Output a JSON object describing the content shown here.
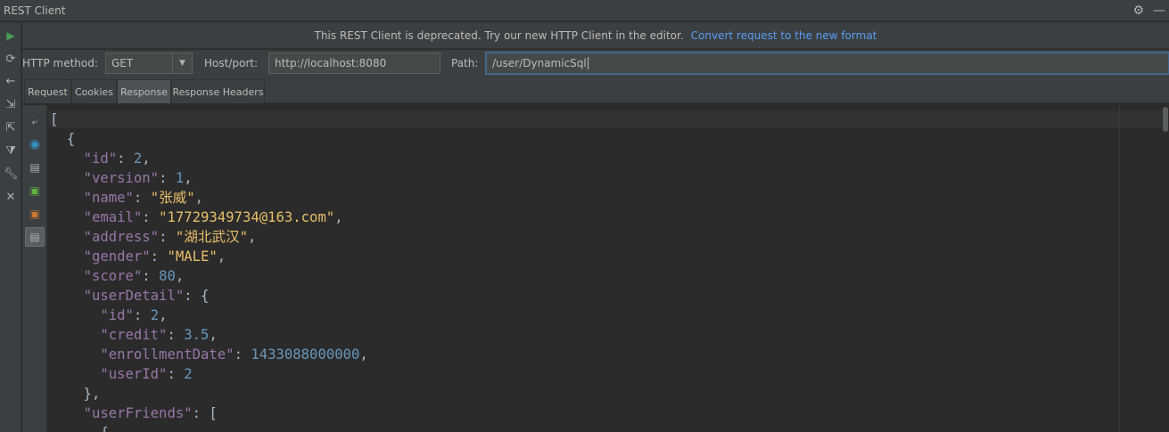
{
  "window": {
    "title": "REST Client"
  },
  "banner": {
    "message": "This REST Client is deprecated. Try our new HTTP Client in the editor.",
    "link": "Convert request to the new format"
  },
  "request": {
    "method_label": "HTTP method:",
    "method_value": "GET",
    "host_label": "Host/port:",
    "host_value": "http://localhost:8080",
    "path_label": "Path:",
    "path_value": "/user/DynamicSql"
  },
  "tabs": [
    {
      "label": "Request"
    },
    {
      "label": "Cookies"
    },
    {
      "label": "Response",
      "active": true
    },
    {
      "label": "Response Headers"
    }
  ],
  "icons": {
    "toolbar": [
      "run-icon",
      "refresh-icon",
      "back-icon",
      "export-icon",
      "import-icon",
      "filter-icon",
      "wrench-icon",
      "close-icon"
    ],
    "response": [
      "soft-wrap-icon",
      "browser-icon",
      "document-icon",
      "html-icon",
      "xml-icon",
      "json-icon"
    ]
  },
  "response_lines": [
    [
      [
        "p",
        "["
      ]
    ],
    [
      [
        "p",
        "  {"
      ]
    ],
    [
      [
        "p",
        "    "
      ],
      [
        "k",
        "\"id\""
      ],
      [
        "p",
        ": "
      ],
      [
        "n",
        "2"
      ],
      [
        "p",
        ","
      ]
    ],
    [
      [
        "p",
        "    "
      ],
      [
        "k",
        "\"version\""
      ],
      [
        "p",
        ": "
      ],
      [
        "n",
        "1"
      ],
      [
        "p",
        ","
      ]
    ],
    [
      [
        "p",
        "    "
      ],
      [
        "k",
        "\"name\""
      ],
      [
        "p",
        ": "
      ],
      [
        "str",
        "\"张威\""
      ],
      [
        "p",
        ","
      ]
    ],
    [
      [
        "p",
        "    "
      ],
      [
        "k",
        "\"email\""
      ],
      [
        "p",
        ": "
      ],
      [
        "str",
        "\"17729349734@163.com\""
      ],
      [
        "p",
        ","
      ]
    ],
    [
      [
        "p",
        "    "
      ],
      [
        "k",
        "\"address\""
      ],
      [
        "p",
        ": "
      ],
      [
        "str",
        "\"湖北武汉\""
      ],
      [
        "p",
        ","
      ]
    ],
    [
      [
        "p",
        "    "
      ],
      [
        "k",
        "\"gender\""
      ],
      [
        "p",
        ": "
      ],
      [
        "str",
        "\"MALE\""
      ],
      [
        "p",
        ","
      ]
    ],
    [
      [
        "p",
        "    "
      ],
      [
        "k",
        "\"score\""
      ],
      [
        "p",
        ": "
      ],
      [
        "n",
        "80"
      ],
      [
        "p",
        ","
      ]
    ],
    [
      [
        "p",
        "    "
      ],
      [
        "k",
        "\"userDetail\""
      ],
      [
        "p",
        ": {"
      ]
    ],
    [
      [
        "p",
        "      "
      ],
      [
        "k",
        "\"id\""
      ],
      [
        "p",
        ": "
      ],
      [
        "n",
        "2"
      ],
      [
        "p",
        ","
      ]
    ],
    [
      [
        "p",
        "      "
      ],
      [
        "k",
        "\"credit\""
      ],
      [
        "p",
        ": "
      ],
      [
        "n",
        "3.5"
      ],
      [
        "p",
        ","
      ]
    ],
    [
      [
        "p",
        "      "
      ],
      [
        "k",
        "\"enrollmentDate\""
      ],
      [
        "p",
        ": "
      ],
      [
        "n",
        "1433088000000"
      ],
      [
        "p",
        ","
      ]
    ],
    [
      [
        "p",
        "      "
      ],
      [
        "k",
        "\"userId\""
      ],
      [
        "p",
        ": "
      ],
      [
        "n",
        "2"
      ]
    ],
    [
      [
        "p",
        "    },"
      ]
    ],
    [
      [
        "p",
        "    "
      ],
      [
        "k",
        "\"userFriends\""
      ],
      [
        "p",
        ": ["
      ]
    ],
    [
      [
        "p",
        "      {"
      ]
    ]
  ]
}
